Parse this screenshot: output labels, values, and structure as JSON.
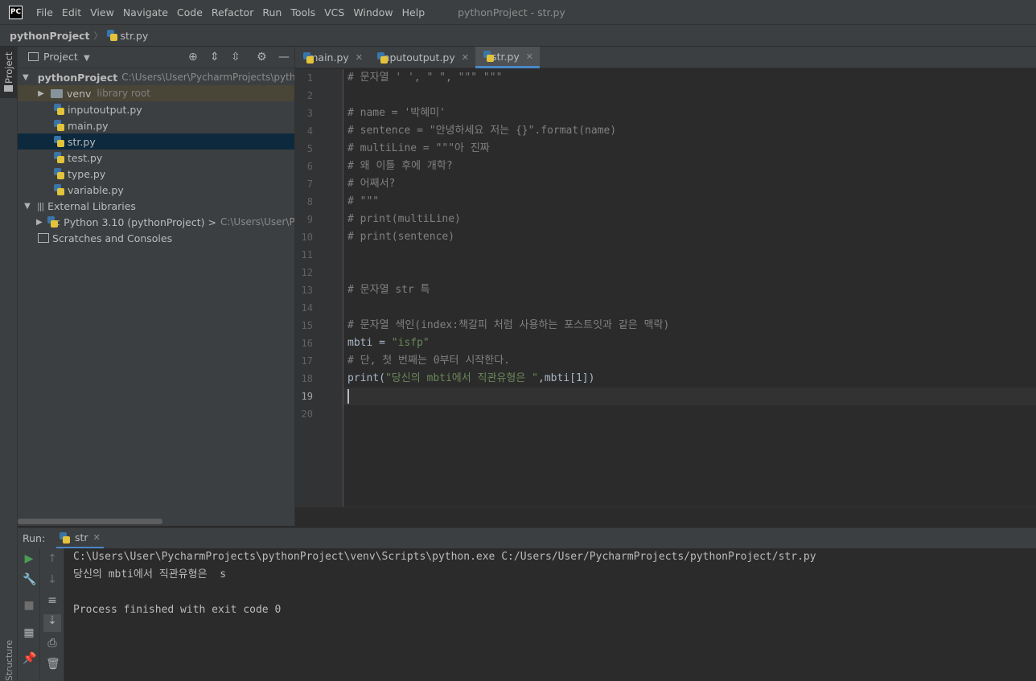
{
  "app": {
    "logo": "PC",
    "window_title": "pythonProject - str.py"
  },
  "menu": [
    "File",
    "Edit",
    "View",
    "Navigate",
    "Code",
    "Refactor",
    "Run",
    "Tools",
    "VCS",
    "Window",
    "Help"
  ],
  "navbar": {
    "project": "pythonProject",
    "file": "str.py"
  },
  "left_stripe": {
    "project_label": "Project",
    "structure_label": "Structure"
  },
  "project_panel": {
    "title": "Project",
    "tree": {
      "root": {
        "name": "pythonProject",
        "path": "C:\\Users\\User\\PycharmProjects\\pytho"
      },
      "venv": {
        "name": "venv",
        "tag": "library root"
      },
      "files": [
        "inputoutput.py",
        "main.py",
        "str.py",
        "test.py",
        "type.py",
        "variable.py"
      ],
      "external": "External Libraries",
      "python_sdk": {
        "name": "< Python 3.10 (pythonProject) >",
        "path": "C:\\Users\\User\\Py"
      },
      "scratches": "Scratches and Consoles"
    }
  },
  "tabs": [
    {
      "label": "main.py",
      "active": false
    },
    {
      "label": "inputoutput.py",
      "active": false
    },
    {
      "label": "str.py",
      "active": true
    }
  ],
  "editor": {
    "current_line": 19,
    "lines": [
      "# 문자열 ' ', \" \", \"\"\" \"\"\"",
      "",
      "# name = '박혜미'",
      "# sentence = \"안녕하세요 저는 {}\".format(name)",
      "# multiLine = \"\"\"아 진짜",
      "# 왜 이틀 후에 개학?",
      "# 어째서?",
      "# \"\"\"",
      "# print(multiLine)",
      "# print(sentence)",
      "",
      "",
      "# 문자열 str 특",
      "",
      "# 문자열 색인(index:책갈피 처럼 사용하는 포스트잇과 같은 맥락)",
      "mbti = \"isfp\"",
      "# 단, 첫 번째는 0부터 시작한다.",
      "print(\"당신의 mbti에서 직관유형은 \",mbti[1])",
      "",
      ""
    ],
    "line_numbers": [
      "1",
      "2",
      "3",
      "4",
      "5",
      "6",
      "7",
      "8",
      "9",
      "10",
      "11",
      "12",
      "13",
      "14",
      "15",
      "16",
      "17",
      "18",
      "19",
      "20"
    ],
    "line16": {
      "var": "mbti = ",
      "str": "\"isfp\""
    },
    "line18": {
      "fn": "print(",
      "str": "\"당신의 mbti에서 직관유형은 \"",
      "rest": ",mbti[1])"
    }
  },
  "run": {
    "label": "Run:",
    "tab": "str",
    "console": [
      "C:\\Users\\User\\PycharmProjects\\pythonProject\\venv\\Scripts\\python.exe C:/Users/User/PycharmProjects/pythonProject/str.py",
      "당신의 mbti에서 직관유형은  s",
      "",
      "Process finished with exit code 0"
    ]
  },
  "colors": {
    "accent": "#4a88c7",
    "comment": "#808080",
    "string": "#6a8759",
    "run_green": "#499c54"
  }
}
